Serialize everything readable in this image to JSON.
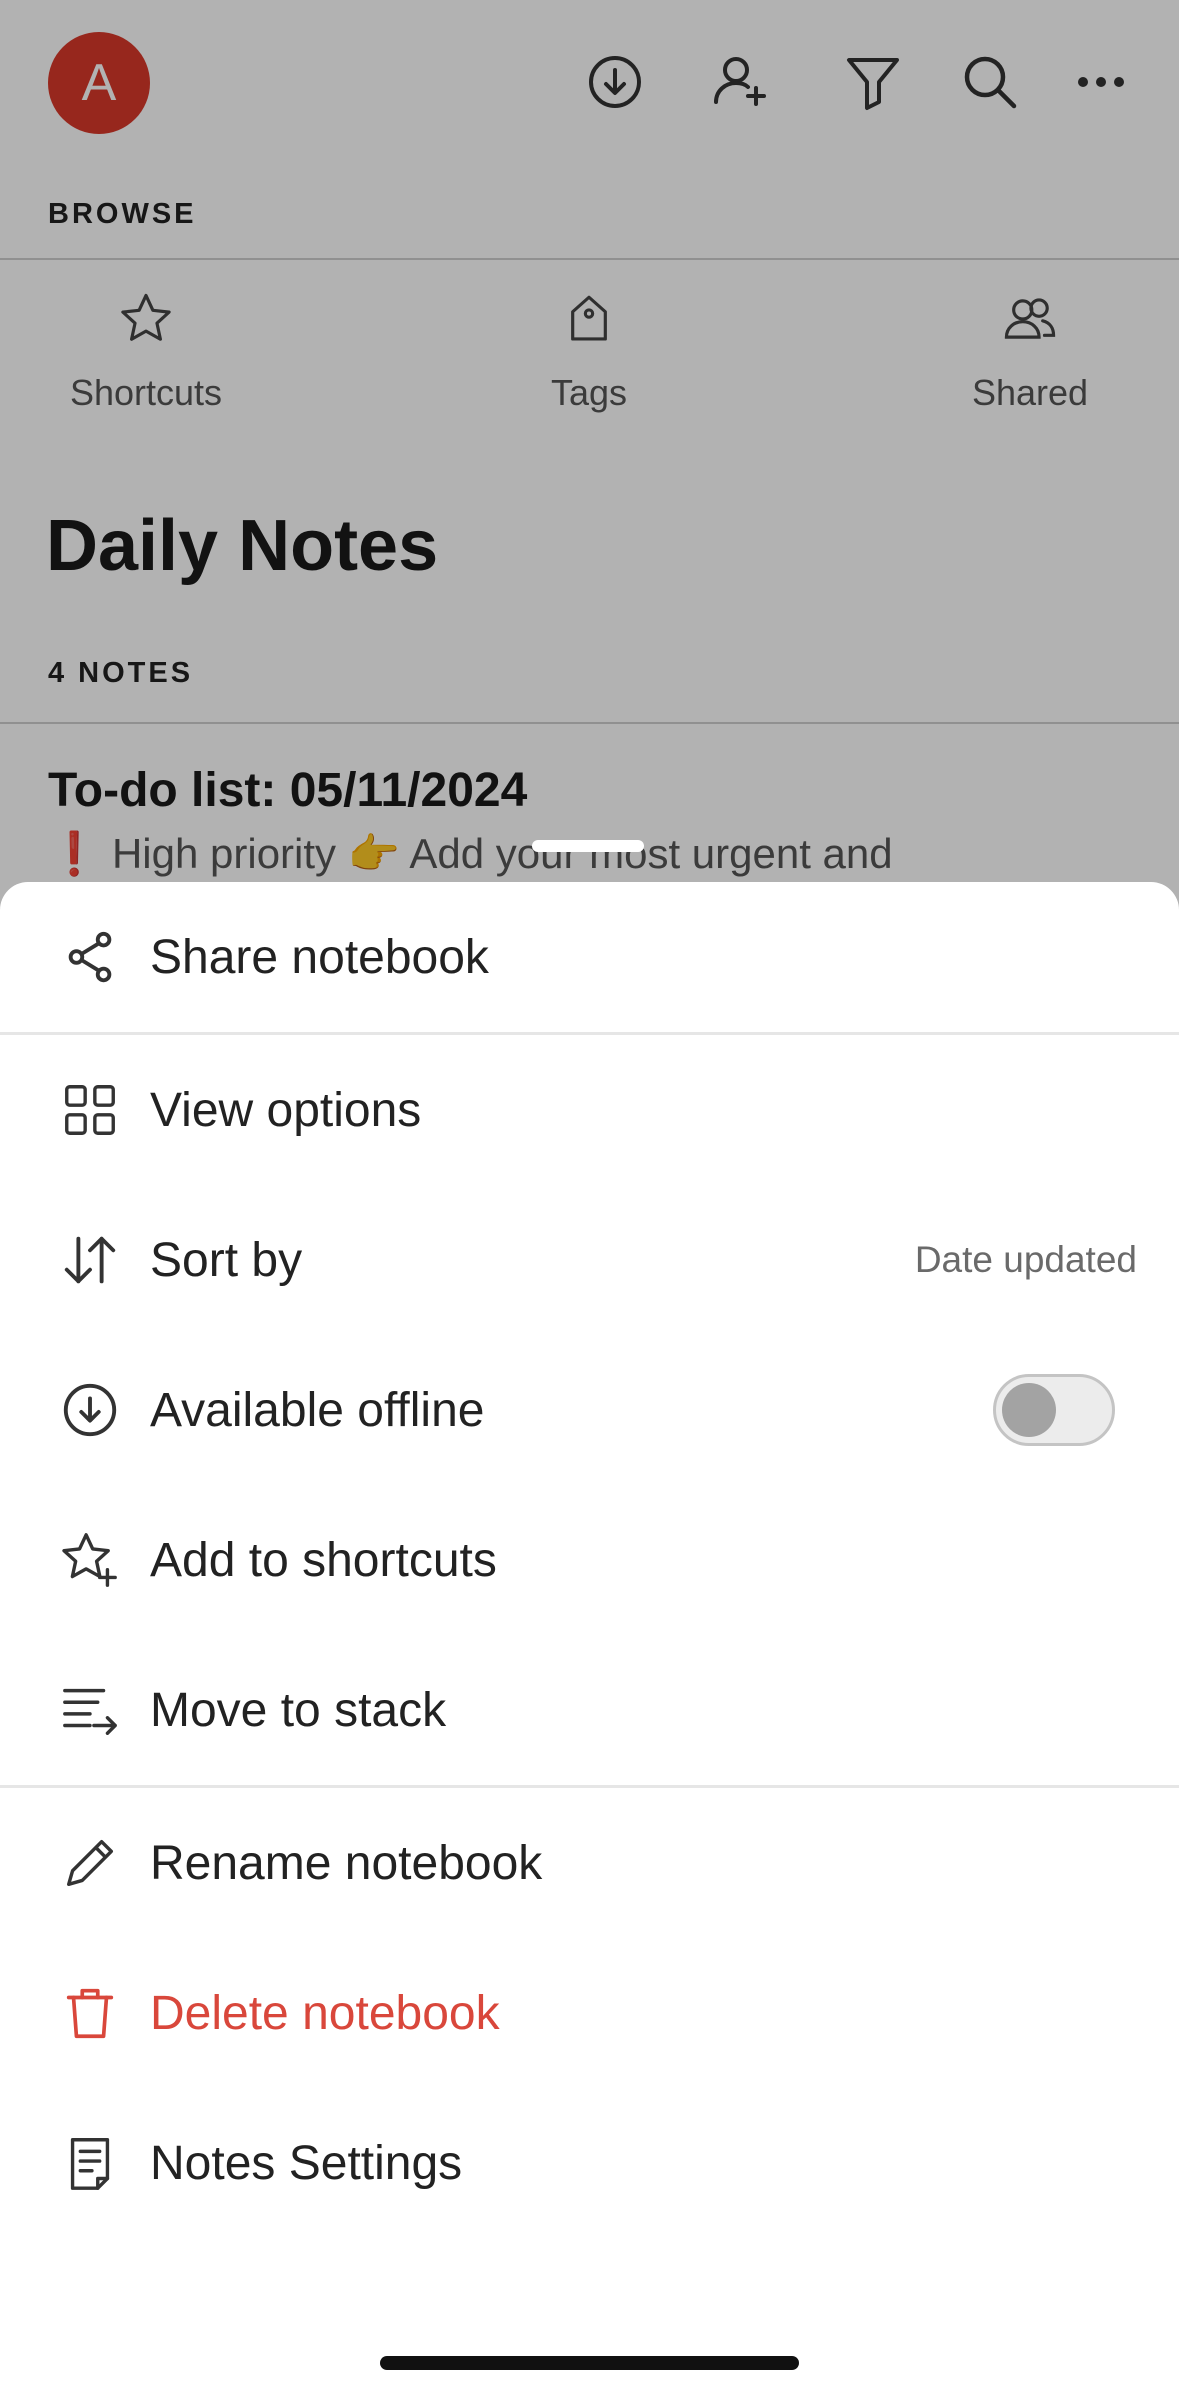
{
  "header": {
    "avatar_initial": "A",
    "icons": [
      "download-circle-icon",
      "add-user-icon",
      "filter-icon",
      "search-icon",
      "more-icon"
    ]
  },
  "browse": {
    "label": "BROWSE",
    "items": [
      {
        "label": "Shortcuts",
        "icon": "star-icon"
      },
      {
        "label": "Tags",
        "icon": "tag-icon"
      },
      {
        "label": "Shared",
        "icon": "people-icon"
      }
    ]
  },
  "notebook": {
    "title": "Daily Notes",
    "count_label": "4 NOTES",
    "note": {
      "title": "To-do list: 05/11/2024",
      "snippet": "❗ High priority 👉 Add your most urgent and"
    }
  },
  "sheet": {
    "share_label": "Share notebook",
    "view_options_label": "View options",
    "sort_by_label": "Sort by",
    "sort_by_value": "Date updated",
    "offline_label": "Available offline",
    "offline_enabled": false,
    "add_shortcut_label": "Add to shortcuts",
    "move_stack_label": "Move to stack",
    "rename_label": "Rename notebook",
    "delete_label": "Delete notebook",
    "settings_label": "Notes Settings"
  },
  "colors": {
    "avatar": "#d8382a",
    "danger": "#d9473b",
    "overlay": "rgba(0,0,0,0.30)"
  }
}
